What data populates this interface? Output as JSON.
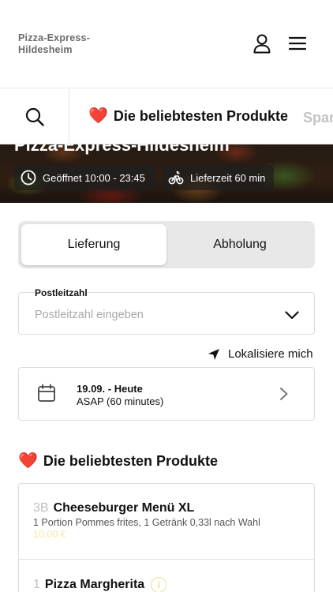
{
  "header": {
    "brand": "Pizza-Express-Hildesheim",
    "icons": {
      "user": "user-icon",
      "menu": "hamburger-menu-icon"
    }
  },
  "categories": {
    "search_icon": "search-icon",
    "active": {
      "emoji": "❤️",
      "label": "Die beliebtesten Produkte"
    },
    "next": {
      "label": "Spar"
    }
  },
  "hero": {
    "title": "Pizza-Express-Hildesheim",
    "opening": "Geöffnet 10:00 - 23:45",
    "delivery_time": "Lieferzeit 60 min"
  },
  "order_type": {
    "delivery": "Lieferung",
    "pickup": "Abholung",
    "selected": "Lieferung"
  },
  "postal": {
    "label": "Postleitzahl",
    "placeholder": "Postleitzahl eingeben",
    "value": ""
  },
  "locate": {
    "label": "Lokalisiere mich"
  },
  "schedule": {
    "date": "19.09. - Heute",
    "time": "ASAP (60 minutes)"
  },
  "section": {
    "emoji": "❤️",
    "title": "Die beliebtesten Produkte"
  },
  "products": [
    {
      "number": "3B",
      "name": "Cheeseburger Menü XL",
      "description": "1 Portion Pommes frites, 1 Getränk 0,33l nach Wahl",
      "price": "10,00 €"
    },
    {
      "number": "1",
      "name": "Pizza Margherita",
      "info": "i"
    }
  ],
  "colors": {
    "accent_heart": "#e0242a",
    "price": "#f5e9a8",
    "border": "#dcdcdc",
    "toggle_bg": "#e8e8e8"
  }
}
